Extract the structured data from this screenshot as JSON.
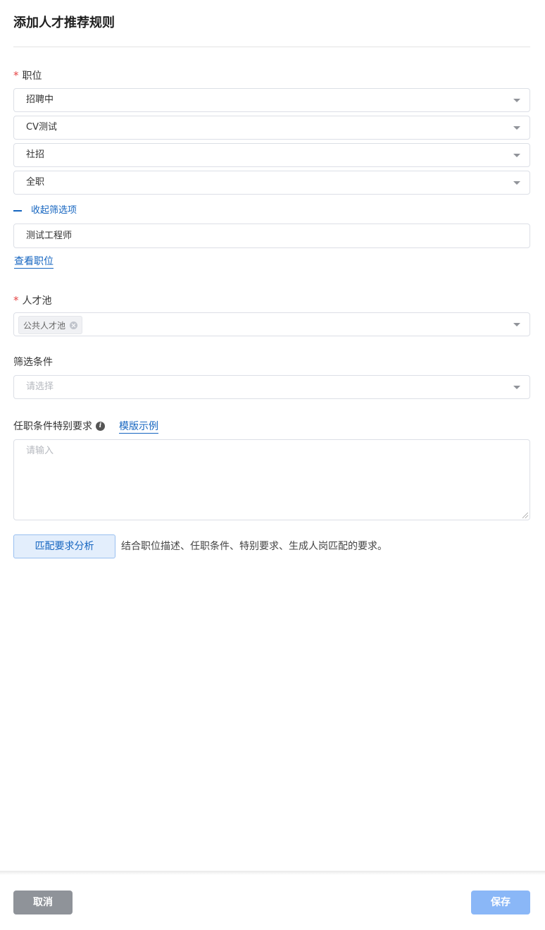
{
  "header": {
    "title": "添加人才推荐规则"
  },
  "position": {
    "label": "职位",
    "required_mark": "*",
    "selects": [
      {
        "value": "招聘中"
      },
      {
        "value": "CV测试"
      },
      {
        "value": "社招"
      },
      {
        "value": "全职"
      }
    ],
    "collapse_label": "收起筛选项",
    "search_value": "测试工程师",
    "view_link": "查看职位"
  },
  "talent_pool": {
    "label": "人才池",
    "required_mark": "*",
    "tags": [
      "公共人才池"
    ]
  },
  "filter": {
    "label": "筛选条件",
    "placeholder": "请选择"
  },
  "requirements": {
    "label": "任职条件特别要求",
    "template_link": "模版示例",
    "placeholder": "请输入"
  },
  "analysis": {
    "button_label": "匹配要求分析",
    "hint": "结合职位描述、任职条件、特别要求、生成人岗匹配的要求。"
  },
  "footer": {
    "cancel_label": "取消",
    "save_label": "保存"
  },
  "colors": {
    "accent": "#1565c0",
    "required": "#e54545",
    "save_button": "#8ab7f7",
    "cancel_button": "#8f9399"
  },
  "icons": [
    "chevron-down-icon",
    "minus-icon",
    "close-icon",
    "info-icon",
    "resize-handle-icon"
  ]
}
